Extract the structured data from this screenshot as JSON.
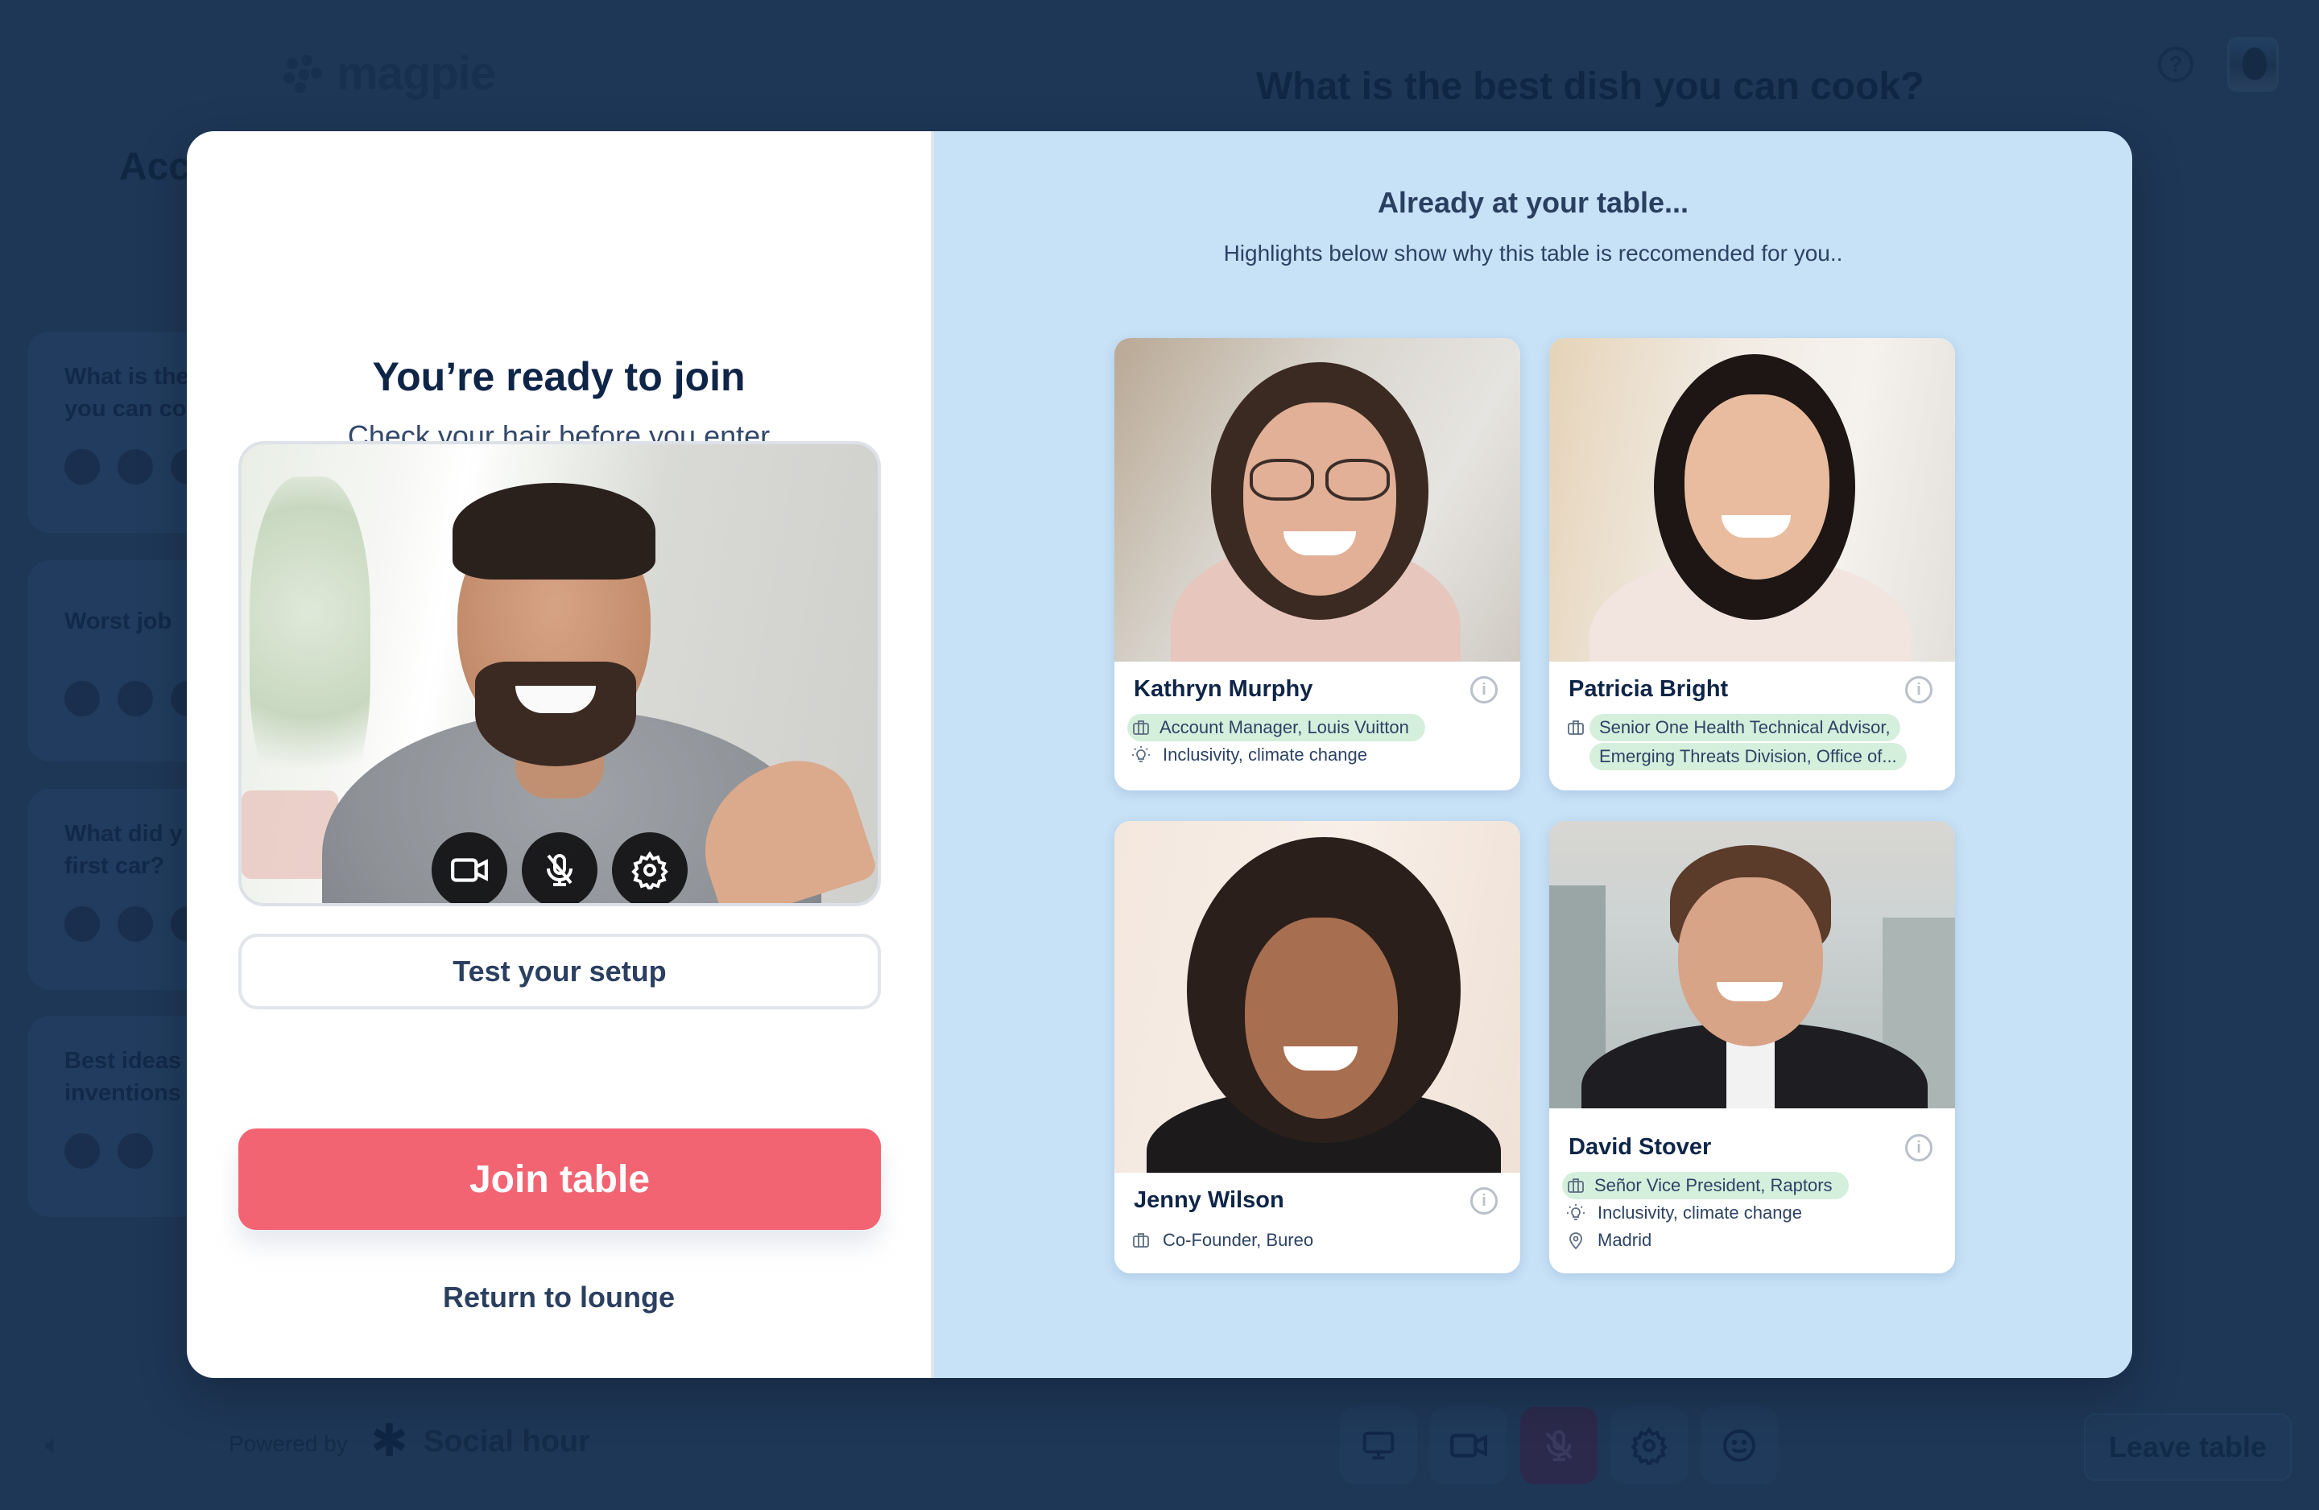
{
  "app": {
    "logo_text": "magpie",
    "question_title": "What is the best dish you can cook?",
    "sidebar_heading": "Acc",
    "sidebar_tables": [
      {
        "question": "What is the best dish you can cook?",
        "visible_text": [
          "What is the",
          "you can co"
        ]
      },
      {
        "question": "Worst job",
        "visible_text": [
          "Worst job"
        ]
      },
      {
        "question": "What did you drive as your first car?",
        "visible_text": [
          "What did y",
          "first car?"
        ]
      },
      {
        "question": "Best ideas inventions",
        "visible_text": [
          "Best ideas",
          "inventions"
        ]
      }
    ],
    "powered_by": "Powered by",
    "brand_name": "Social hour",
    "toolbar": {
      "leave_label": "Leave table",
      "icons": [
        "screen-share-icon",
        "camera-icon",
        "mic-off-icon",
        "gear-icon",
        "emoji-icon"
      ]
    },
    "colors": {
      "background": "#1e3757",
      "mic_muted": "#2b2a4c"
    }
  },
  "modal": {
    "left": {
      "title": "You’re ready to join",
      "subtitle": "Check your hair before you enter",
      "camera_controls": [
        "camera-icon",
        "mic-off-icon",
        "gear-icon"
      ],
      "test_setup_label": "Test your setup",
      "join_label": "Join table",
      "return_label": "Return to lounge"
    },
    "right": {
      "title": "Already at your table...",
      "subtitle": "Highlights below show why this table is reccomended for you..",
      "participants": [
        {
          "name": "Kathryn Murphy",
          "job": "Account Manager, Louis Vuitton",
          "job_highlighted": true,
          "interests": "Inclusivity, climate change",
          "location": null
        },
        {
          "name": "Patricia Bright",
          "job_lines": [
            "Senior One Health Technical Advisor,",
            "Emerging Threats Division, Office of..."
          ],
          "job_highlighted": true,
          "interests": null,
          "location": null
        },
        {
          "name": "Jenny Wilson",
          "job": "Co-Founder, Bureo",
          "job_highlighted": false,
          "interests": null,
          "location": null
        },
        {
          "name": "David Stover",
          "job": "Señor Vice President, Raptors",
          "job_highlighted": true,
          "interests": "Inclusivity, climate change",
          "location": "Madrid"
        }
      ]
    },
    "colors": {
      "join_button": "#f36473",
      "right_panel": "#c7e1f6",
      "highlight": "#d5efdd",
      "title_text": "#0f2548"
    }
  }
}
